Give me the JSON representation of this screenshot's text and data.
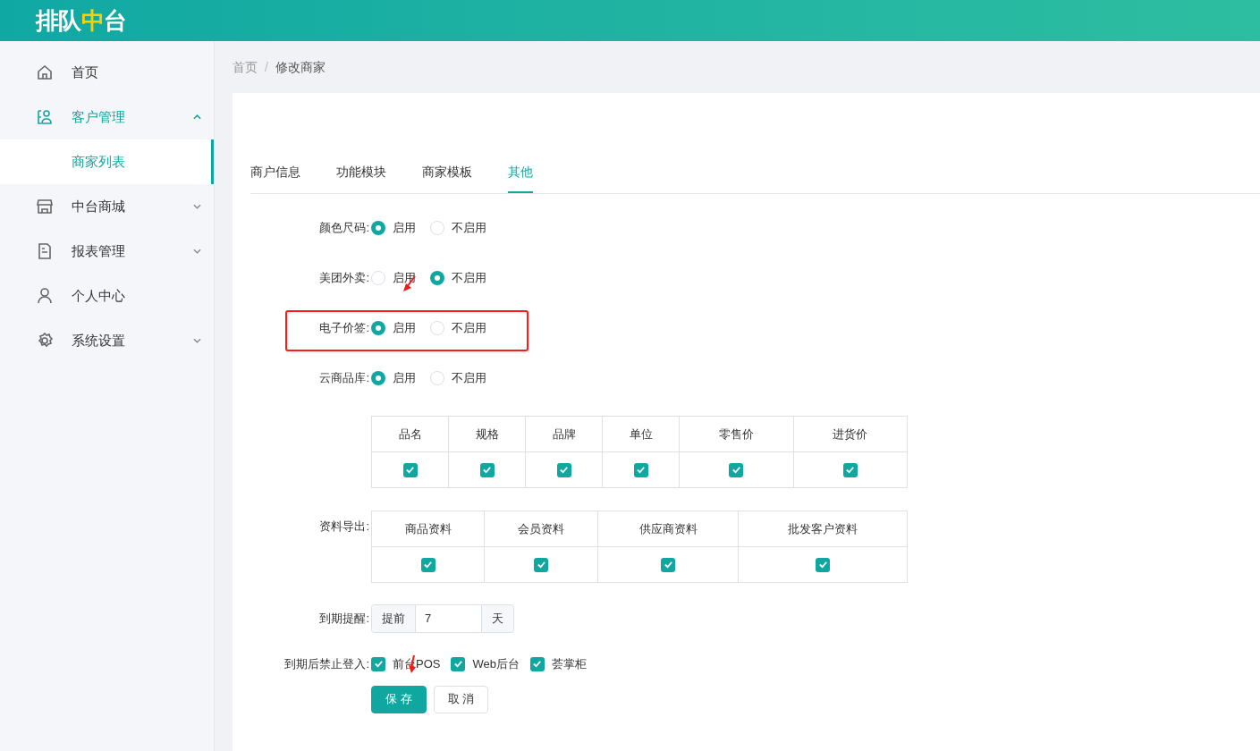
{
  "header": {
    "logo": [
      {
        "text": "排队",
        "highlight": false
      },
      {
        "text": "中",
        "highlight": true
      },
      {
        "text": "台",
        "highlight": false
      }
    ]
  },
  "sidebar": {
    "items": [
      {
        "label": "首页",
        "selected": false
      },
      {
        "label": "客户管理",
        "expanded": true,
        "selected": true,
        "children": [
          {
            "label": "商家列表",
            "selected": true
          }
        ]
      },
      {
        "label": "中台商城",
        "expanded": false,
        "selected": false
      },
      {
        "label": "报表管理",
        "expanded": false,
        "selected": false
      },
      {
        "label": "个人中心",
        "selected": false
      },
      {
        "label": "系统设置",
        "expanded": false,
        "selected": false
      }
    ]
  },
  "breadcrumb": {
    "items": [
      "首页",
      "修改商家"
    ],
    "separator": "/"
  },
  "tabs": [
    {
      "label": "商户信息",
      "selected": false
    },
    {
      "label": "功能模块",
      "selected": false
    },
    {
      "label": "商家模板",
      "selected": false
    },
    {
      "label": "其他",
      "selected": true
    }
  ],
  "form": [
    {
      "kind": "radio",
      "label": "颜色尺码:",
      "options": [
        {
          "label": "启用",
          "selected": true
        },
        {
          "label": "不启用",
          "selected": false
        }
      ]
    },
    {
      "kind": "radio",
      "label": "美团外卖:",
      "options": [
        {
          "label": "启用",
          "selected": false
        },
        {
          "label": "不启用",
          "selected": true
        }
      ]
    },
    {
      "kind": "radio",
      "label": "电子价签:",
      "highlighted": true,
      "options": [
        {
          "label": "启用",
          "selected": true
        },
        {
          "label": "不启用",
          "selected": false
        }
      ]
    },
    {
      "kind": "radio",
      "label": "云商品库:",
      "options": [
        {
          "label": "启用",
          "selected": true
        },
        {
          "label": "不启用",
          "selected": false
        }
      ]
    },
    {
      "kind": "table",
      "columns": [
        {
          "label": "品名",
          "checked": true
        },
        {
          "label": "规格",
          "checked": true
        },
        {
          "label": "品牌",
          "checked": true
        },
        {
          "label": "单位",
          "checked": true
        },
        {
          "label": "零售价",
          "checked": true
        },
        {
          "label": "进货价",
          "checked": true
        }
      ]
    },
    {
      "kind": "table",
      "label": "资料导出:",
      "columns": [
        {
          "label": "商品资料",
          "checked": true
        },
        {
          "label": "会员资料",
          "checked": true
        },
        {
          "label": "供应商资料",
          "checked": true
        },
        {
          "label": "批发客户资料",
          "checked": true
        }
      ]
    },
    {
      "kind": "input",
      "label": "到期提醒:",
      "prefix": "提前",
      "value": "7",
      "suffix": "天"
    },
    {
      "kind": "checkboxes",
      "label": "到期后禁止登入:",
      "options": [
        {
          "label": "前台POS",
          "checked": true
        },
        {
          "label": "Web后台",
          "checked": true
        },
        {
          "label": "荟掌柜",
          "checked": true
        }
      ]
    }
  ],
  "buttons": [
    {
      "label": "保 存",
      "kind": "primary"
    },
    {
      "label": "取 消",
      "kind": "default"
    }
  ]
}
